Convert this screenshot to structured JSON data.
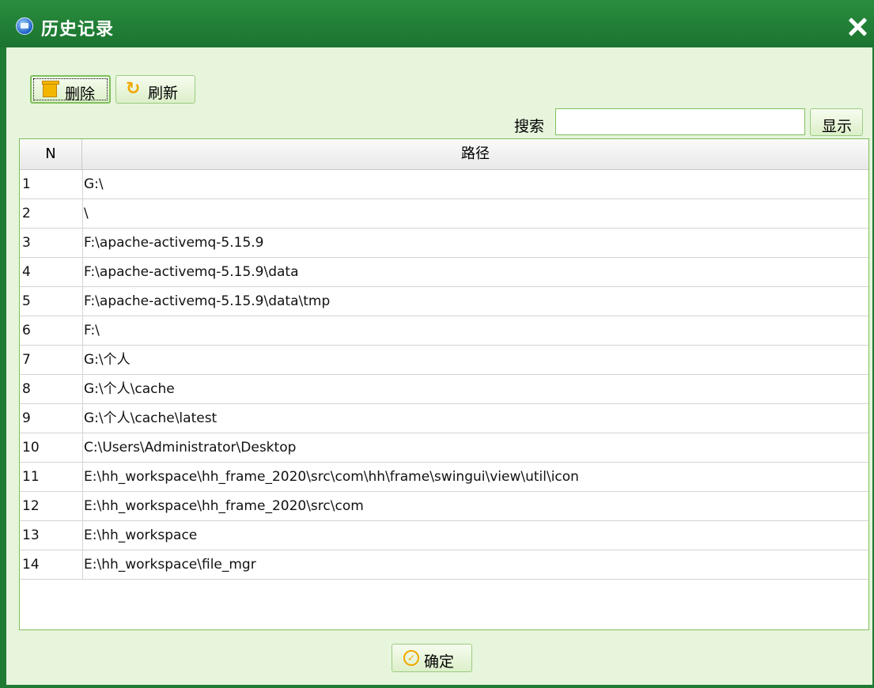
{
  "window": {
    "title": "历史记录"
  },
  "toolbar": {
    "delete_label": "删除",
    "refresh_label": "刷新"
  },
  "search": {
    "label": "搜索",
    "value": "",
    "show_label": "显示"
  },
  "table": {
    "columns": [
      "N",
      "路径"
    ],
    "rows": [
      {
        "n": "1",
        "path": "G:\\"
      },
      {
        "n": "2",
        "path": "\\"
      },
      {
        "n": "3",
        "path": "F:\\apache-activemq-5.15.9"
      },
      {
        "n": "4",
        "path": "F:\\apache-activemq-5.15.9\\data"
      },
      {
        "n": "5",
        "path": "F:\\apache-activemq-5.15.9\\data\\tmp"
      },
      {
        "n": "6",
        "path": "F:\\"
      },
      {
        "n": "7",
        "path": "G:\\个人"
      },
      {
        "n": "8",
        "path": "G:\\个人\\cache"
      },
      {
        "n": "9",
        "path": "G:\\个人\\cache\\latest"
      },
      {
        "n": "10",
        "path": "C:\\Users\\Administrator\\Desktop"
      },
      {
        "n": "11",
        "path": "E:\\hh_workspace\\hh_frame_2020\\src\\com\\hh\\frame\\swingui\\view\\util\\icon"
      },
      {
        "n": "12",
        "path": "E:\\hh_workspace\\hh_frame_2020\\src\\com"
      },
      {
        "n": "13",
        "path": "E:\\hh_workspace"
      },
      {
        "n": "14",
        "path": "E:\\hh_workspace\\file_mgr"
      }
    ]
  },
  "footer": {
    "confirm_label": "确定"
  },
  "colors": {
    "titlebar": "#1f7a32",
    "panel_background": "#e6f5dc",
    "border_green": "#7fc05b",
    "icon_orange": "#f0a800"
  }
}
